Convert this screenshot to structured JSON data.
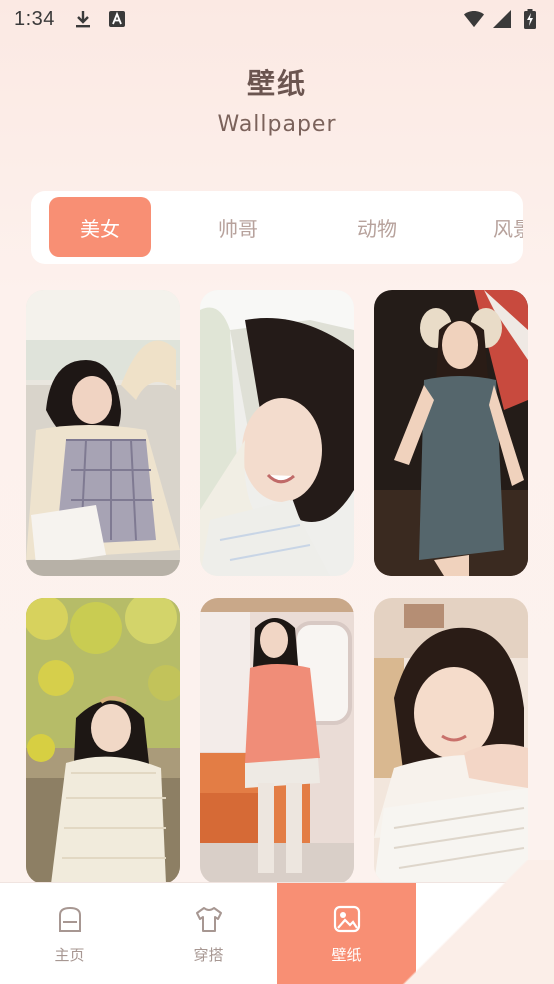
{
  "status_bar": {
    "time": "1:34",
    "left_icons": [
      "download-icon",
      "a-badge-icon"
    ],
    "right_icons": [
      "wifi-icon",
      "signal-icon",
      "battery-charging-icon"
    ]
  },
  "header": {
    "title": "壁纸",
    "subtitle": "Wallpaper"
  },
  "tabs": [
    {
      "label": "美女",
      "active": true
    },
    {
      "label": "帅哥",
      "active": false
    },
    {
      "label": "动物",
      "active": false
    },
    {
      "label": "风景",
      "active": false
    }
  ],
  "wallpapers": [
    {
      "name": "girl-reading-sofa"
    },
    {
      "name": "girl-lying-smiling"
    },
    {
      "name": "girl-earmuffs-denim-dress"
    },
    {
      "name": "girl-under-yellow-flowers"
    },
    {
      "name": "girl-pink-sweater"
    },
    {
      "name": "girl-leaning-on-book"
    }
  ],
  "bottom_nav": [
    {
      "label": "主页",
      "icon": "home-icon",
      "active": false
    },
    {
      "label": "穿搭",
      "icon": "tshirt-icon",
      "active": false
    },
    {
      "label": "壁纸",
      "icon": "wallpaper-icon",
      "active": true
    }
  ],
  "colors": {
    "accent": "#f88f74",
    "tab_inactive_text": "#b7a29c",
    "title_text": "#6b5550"
  }
}
